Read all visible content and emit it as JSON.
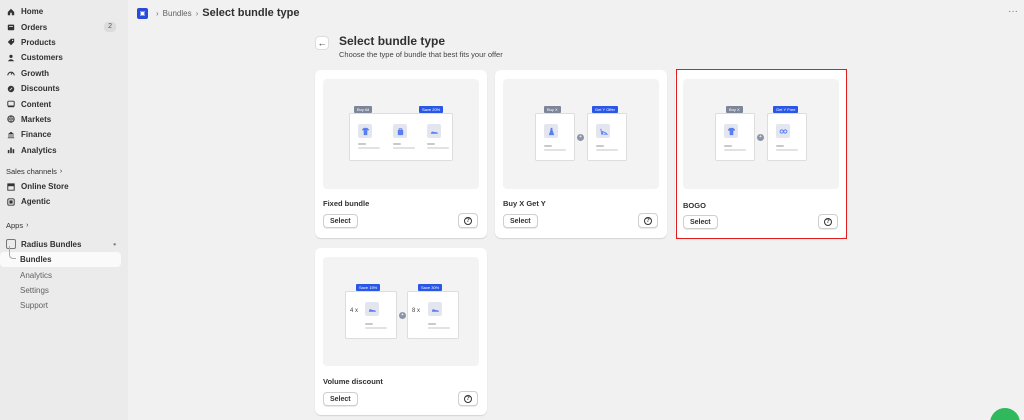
{
  "sidebar": {
    "items": [
      {
        "label": "Home",
        "icon": "home-icon"
      },
      {
        "label": "Orders",
        "icon": "orders-icon",
        "badge": "2"
      },
      {
        "label": "Products",
        "icon": "tag-icon"
      },
      {
        "label": "Customers",
        "icon": "person-icon"
      },
      {
        "label": "Growth",
        "icon": "gauge-icon"
      },
      {
        "label": "Discounts",
        "icon": "discount-icon"
      },
      {
        "label": "Content",
        "icon": "content-icon"
      },
      {
        "label": "Markets",
        "icon": "globe-icon"
      },
      {
        "label": "Finance",
        "icon": "bank-icon"
      },
      {
        "label": "Analytics",
        "icon": "chart-icon"
      }
    ],
    "sales_channels_label": "Sales channels",
    "channels": [
      {
        "label": "Online Store",
        "icon": "store-icon"
      },
      {
        "label": "Agentic",
        "icon": "agentic-icon"
      }
    ],
    "apps_label": "Apps",
    "app_name": "Radius Bundles",
    "app_subitems": [
      "Bundles",
      "Analytics",
      "Settings",
      "Support"
    ]
  },
  "breadcrumb": {
    "parent": "Bundles",
    "current": "Select bundle type"
  },
  "header": {
    "title": "Select bundle type",
    "subtitle": "Choose the type of bundle that best fits your offer"
  },
  "cards": [
    {
      "name": "Fixed bundle",
      "select_label": "Select",
      "tags": [
        "Buy All",
        "Save 20%"
      ]
    },
    {
      "name": "Buy X Get Y",
      "select_label": "Select",
      "tags": [
        "Buy X",
        "Get Y Offer"
      ]
    },
    {
      "name": "BOGO",
      "select_label": "Select",
      "tags": [
        "Buy X",
        "Get Y Free"
      ],
      "selected": true
    },
    {
      "name": "Volume discount",
      "select_label": "Select",
      "tags": [
        "Save 15%",
        "Save 30%"
      ],
      "qty": [
        "4 x",
        "8 x"
      ]
    }
  ],
  "help_symbol": "?",
  "colors": {
    "selected_outline": "#e01e1e",
    "tag_blue": "#2a57e6",
    "tag_gray": "#7d8699",
    "fab": "#2fb85c"
  }
}
